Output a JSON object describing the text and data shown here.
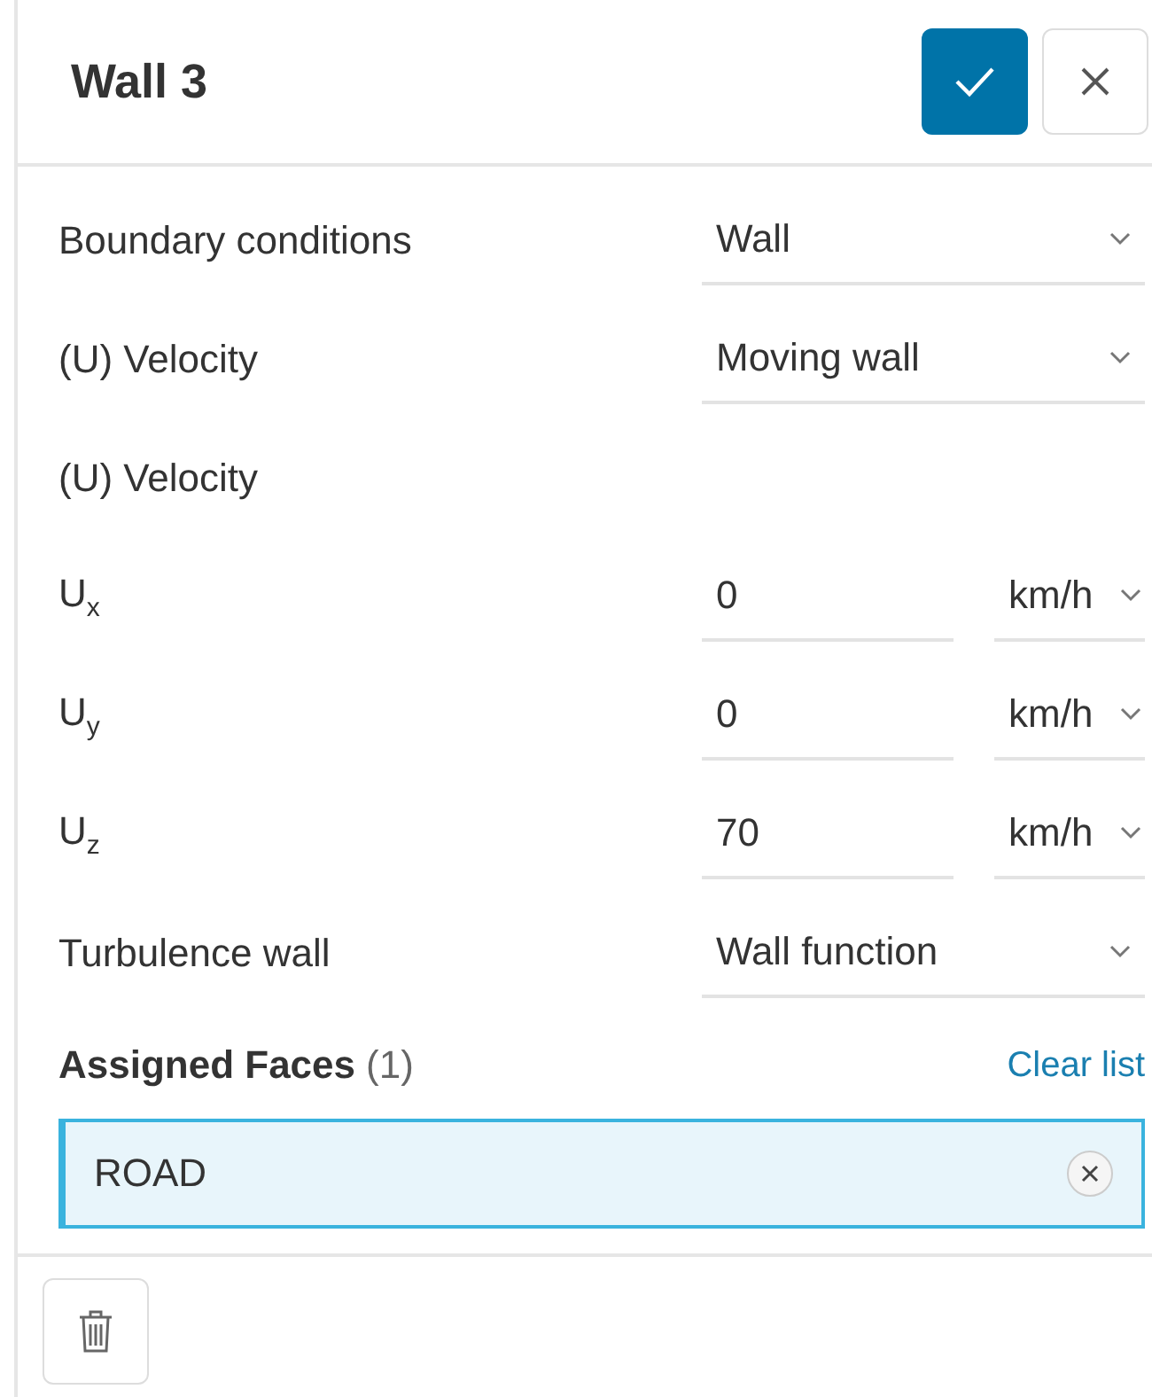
{
  "panel": {
    "title": "Wall 3"
  },
  "rows": [
    {
      "kind": "select",
      "label": "Boundary conditions",
      "value": "Wall"
    },
    {
      "kind": "select",
      "label": "(U) Velocity",
      "value": "Moving wall"
    },
    {
      "kind": "heading",
      "label": "(U) Velocity"
    },
    {
      "kind": "number_unit",
      "label": "U$_{x}$",
      "value": "0",
      "unit": "km/h"
    },
    {
      "kind": "number_unit",
      "label": "U$_{y}$",
      "value": "0",
      "unit": "km/h"
    },
    {
      "kind": "number_unit",
      "label": "U$_{z}$",
      "value": "70",
      "unit": "km/h"
    },
    {
      "kind": "select",
      "label": "Turbulence wall",
      "value": "Wall function"
    }
  ],
  "assigned_faces": {
    "title": "Assigned Faces",
    "count": "(1)",
    "clear_link": "Clear list",
    "items": [
      {
        "label": "ROAD"
      }
    ]
  }
}
